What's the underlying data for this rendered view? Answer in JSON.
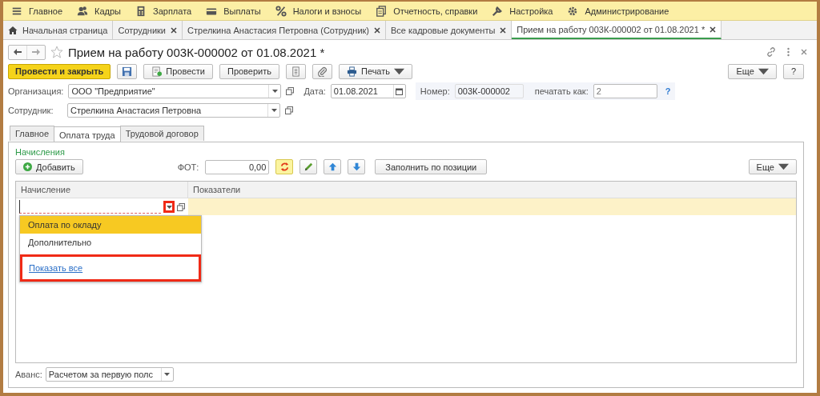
{
  "menu": [
    {
      "label": "Главное"
    },
    {
      "label": "Кадры"
    },
    {
      "label": "Зарплата"
    },
    {
      "label": "Выплаты"
    },
    {
      "label": "Налоги и взносы"
    },
    {
      "label": "Отчетность, справки"
    },
    {
      "label": "Настройка"
    },
    {
      "label": "Администрирование"
    }
  ],
  "tabs": [
    {
      "label": "Начальная страница",
      "kind": "home",
      "selected": false
    },
    {
      "label": "Сотрудники",
      "kind": "closable",
      "selected": false
    },
    {
      "label": "Стрелкина Анастасия Петровна (Сотрудник)",
      "kind": "closable",
      "selected": false
    },
    {
      "label": "Все кадровые документы",
      "kind": "closable",
      "selected": false
    },
    {
      "label": "Прием на работу 003К-000002 от 01.08.2021 *",
      "kind": "closable",
      "selected": true
    }
  ],
  "document": {
    "title": "Прием на работу 003К-000002 от 01.08.2021 *",
    "favorite": false
  },
  "toolbar": {
    "buttons": [
      {
        "label": "Провести и закрыть",
        "kind": "primary"
      },
      {
        "kind": "save"
      },
      {
        "label": "Провести",
        "kind": "post"
      },
      {
        "label": "Проверить",
        "kind": "text"
      },
      {
        "kind": "list"
      },
      {
        "kind": "attach"
      },
      {
        "label": "Печать",
        "kind": "print"
      }
    ],
    "right": [
      {
        "label": "Еще",
        "kind": "menu"
      },
      {
        "label": "?",
        "kind": "text"
      }
    ]
  },
  "fields": {
    "organization": {
      "label": "Организация:",
      "value": "ООО \"Предприятие\""
    },
    "date": {
      "label": "Дата:",
      "value": "01.08.2021"
    },
    "number": {
      "label": "Номер:",
      "value": "003К-000002"
    },
    "print_as": {
      "label": "печатать как:",
      "placeholder": "2"
    },
    "help": "?",
    "employee": {
      "label": "Сотрудник:",
      "value": "Стрелкина Анастасия Петровна"
    }
  },
  "form_tabs": [
    {
      "label": "Главное",
      "selected": false
    },
    {
      "label": "Оплата труда",
      "selected": true
    },
    {
      "label": "Трудовой договор",
      "selected": false
    }
  ],
  "accruals": {
    "title": "Начисления",
    "add": "Добавить",
    "fot_label": "ФОТ:",
    "fot_value": "0,00",
    "tool_buttons": [
      {
        "kind": "refresh",
        "on": true
      },
      {
        "kind": "edit",
        "on": false
      },
      {
        "kind": "up",
        "on": false
      },
      {
        "kind": "down",
        "on": false
      }
    ],
    "fill": "Заполнить по позиции",
    "more": "Еще",
    "columns": [
      "Начисление",
      "Показатели"
    ],
    "edit_row": {
      "required": true,
      "arrow_highlighted": true
    },
    "dropdown": {
      "items": [
        {
          "label": "Оплата по окладу",
          "selected": true
        },
        {
          "label": "Дополнительно",
          "selected": false
        }
      ],
      "show_all": {
        "label": "Показать все",
        "highlighted": true
      }
    }
  },
  "advance": {
    "label": "Аванс:",
    "value": "Расчетом за первую полс"
  }
}
